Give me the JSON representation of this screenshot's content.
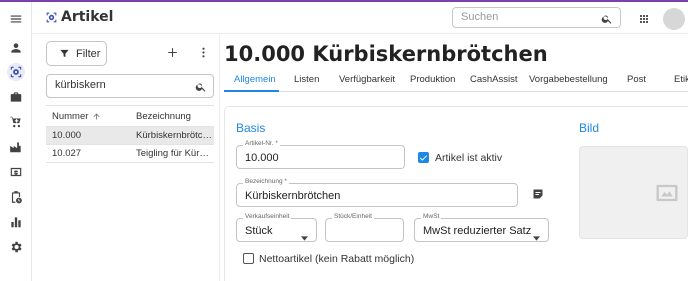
{
  "app": {
    "title": "Artikel"
  },
  "header": {
    "search_placeholder": "Suchen"
  },
  "rail": {
    "items": [
      "menu-icon",
      "person-icon",
      "article-icon",
      "briefcase-icon",
      "cart-icon",
      "factory-icon",
      "payment-icon",
      "clipboard-clock-icon",
      "chart-icon",
      "settings-icon"
    ],
    "active_index": 2
  },
  "list": {
    "filter_label": "Filter",
    "search_value": "kürbiskern",
    "columns": {
      "number": "Nummer",
      "description": "Bezeichnung"
    },
    "rows": [
      {
        "number": "10.000",
        "description": "Kürbiskernbrötchen",
        "selected": true
      },
      {
        "number": "10.027",
        "description": "Teigling für Kürbiskernbrötchen",
        "selected": false
      }
    ]
  },
  "detail": {
    "title": "10.000 Kürbiskernbrötchen",
    "tabs": [
      "Allgemein",
      "Listen",
      "Verfügbarkeit",
      "Produktion",
      "CashAssist",
      "Vorgabebestellung",
      "Post",
      "Etik"
    ],
    "active_tab": "Allgemein",
    "basis": {
      "title": "Basis",
      "article_no_label": "Artikel-Nr. *",
      "article_no_value": "10.000",
      "active_checkbox_label": "Artikel ist aktiv",
      "active_checked": true,
      "name_label": "Bezeichnung *",
      "name_value": "Kürbiskernbrötchen",
      "unit_label": "Verkaufseinheit",
      "unit_value": "Stück",
      "per_unit_label": "Stück/Einheit",
      "per_unit_value": "",
      "vat_label": "MwSt",
      "vat_value": "MwSt reduzierter Satz",
      "net_checkbox_label": "Nettoartikel (kein Rabatt möglich)",
      "net_checked": false
    },
    "image": {
      "title": "Bild"
    }
  },
  "colors": {
    "accent": "#1e88e5",
    "brand": "#3f51b5",
    "topline": "#7a3fb0"
  }
}
